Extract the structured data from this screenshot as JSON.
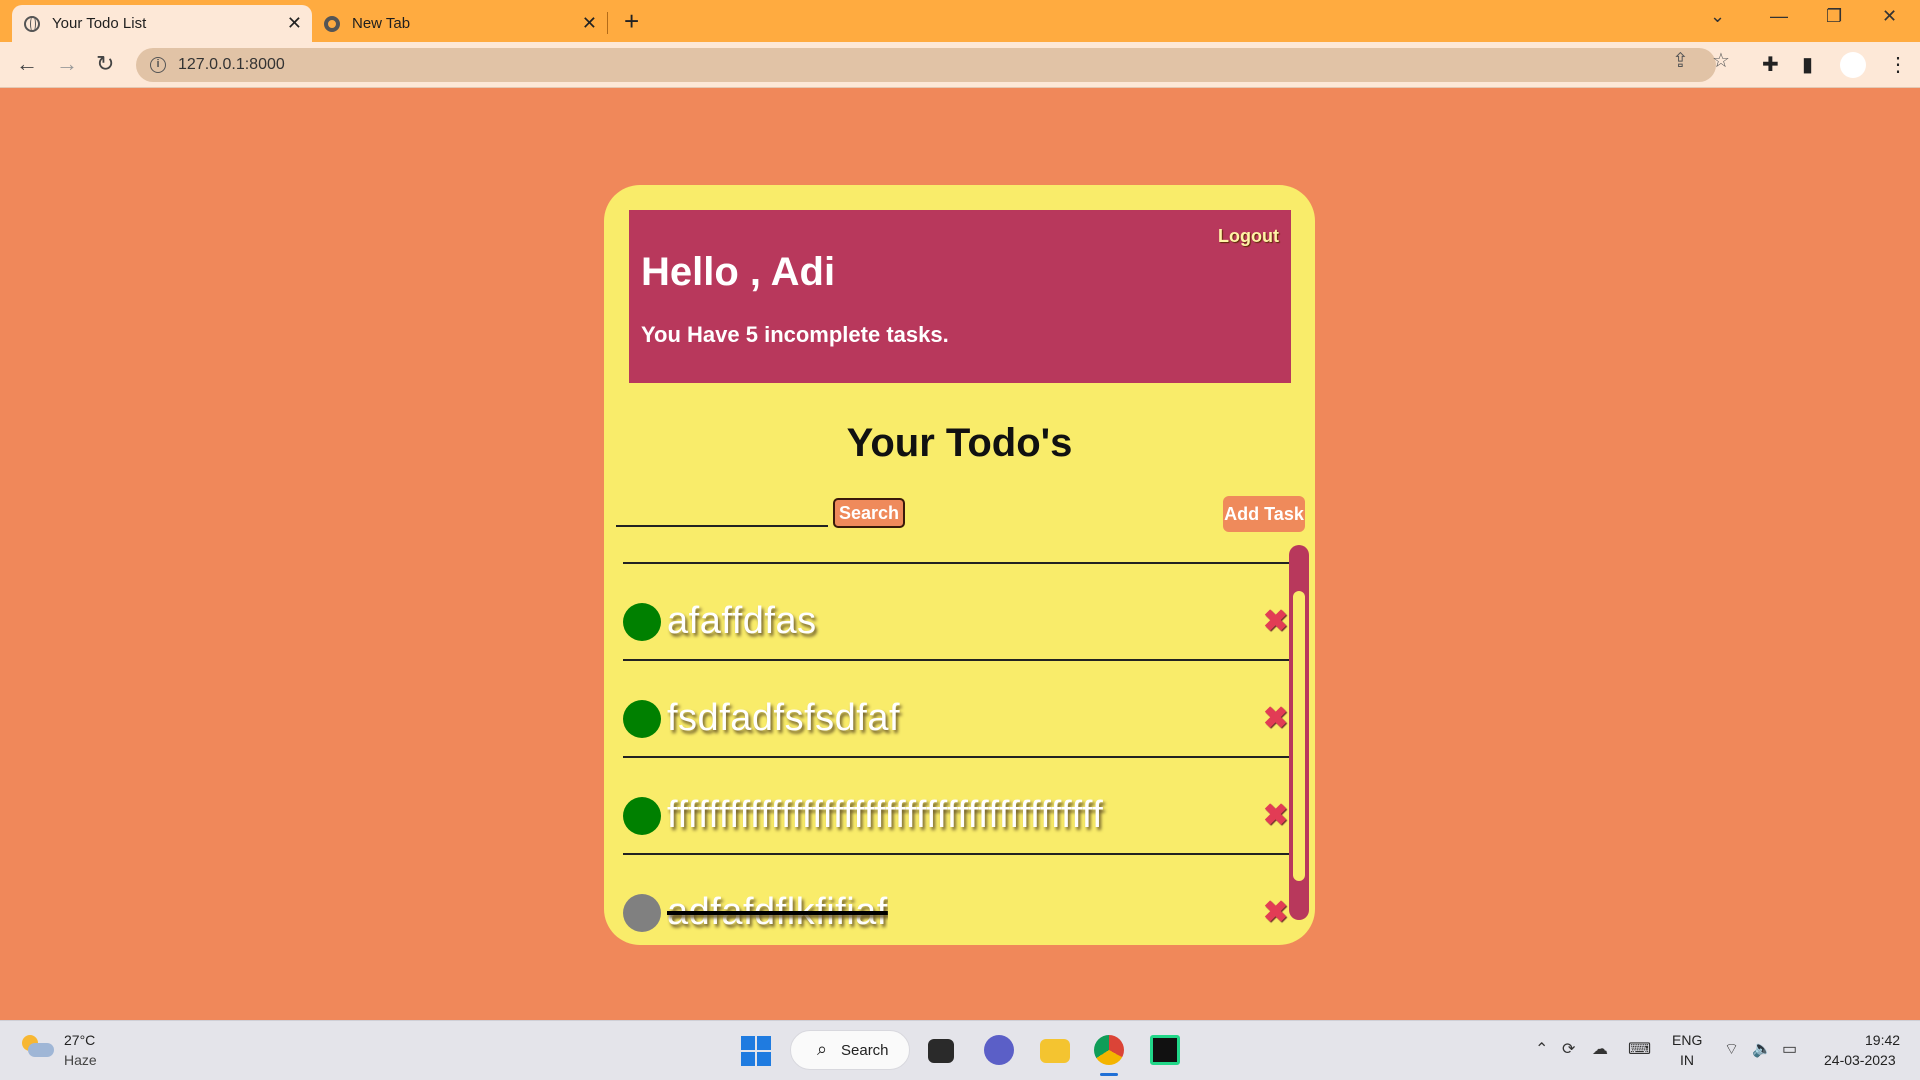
{
  "browser": {
    "tabs": [
      {
        "title": "Your Todo List",
        "active": true
      },
      {
        "title": "New Tab",
        "active": false
      }
    ],
    "url": "127.0.0.1:8000"
  },
  "app": {
    "logout_label": "Logout",
    "greeting": "Hello , Adi",
    "incomplete_message": "You Have 5 incomplete tasks.",
    "list_title": "Your Todo's",
    "search": {
      "value": "",
      "button_label": "Search"
    },
    "add_task_label": "Add Task",
    "tasks": [
      {
        "title": "afaffdfas",
        "completed": false,
        "delete_icon": "✖"
      },
      {
        "title": "fsdfadfsfsdfaf",
        "completed": false,
        "delete_icon": "✖"
      },
      {
        "title": "ffffffffffffffffffffffffffffffffffffffffff",
        "completed": false,
        "delete_icon": "✖"
      },
      {
        "title": "adfafdflkfifiaf",
        "completed": true,
        "delete_icon": "✖"
      }
    ],
    "colors": {
      "page_bg": "#f0885a",
      "card_bg": "#f9ec6a",
      "header_bg": "#b8385c",
      "incomplete_dot": "#008000",
      "complete_dot": "#808080",
      "delete": "#e23c55"
    }
  },
  "taskbar": {
    "weather": {
      "temp": "27°C",
      "condition": "Haze"
    },
    "search_label": "Search",
    "lang_line1": "ENG",
    "lang_line2": "IN",
    "time": "19:42",
    "date": "24-03-2023"
  }
}
